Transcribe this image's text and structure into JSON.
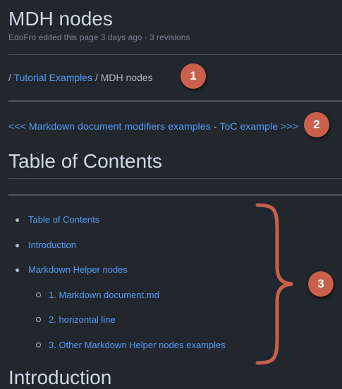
{
  "page": {
    "title": "MDH nodes",
    "meta": "EdoFro edited this page 3 days ago · 3 revisions"
  },
  "breadcrumb": {
    "sep1": "/ ",
    "link": "Tutorial Examples",
    "sep2": " / ",
    "current": "MDH nodes"
  },
  "nav": {
    "prev": "<<< Markdown document modifiers examples",
    "sep": " - ",
    "next": "ToC example >>>"
  },
  "toc_heading": "Table of Contents",
  "toc": {
    "items": [
      "Table of Contents",
      "Introduction",
      "Markdown Helper nodes"
    ],
    "subitems": [
      "1. Markdown document.md",
      "2. horizontal line",
      "3. Other Markdown Helper nodes examples"
    ]
  },
  "intro_heading": "Introduction",
  "annotations": {
    "badge1": "1",
    "badge2": "2",
    "badge3": "3",
    "color": "#c9604a"
  },
  "colors": {
    "background": "#22272e",
    "link": "#539bf5",
    "text": "#adbac7",
    "heading": "#cdd9e5"
  }
}
